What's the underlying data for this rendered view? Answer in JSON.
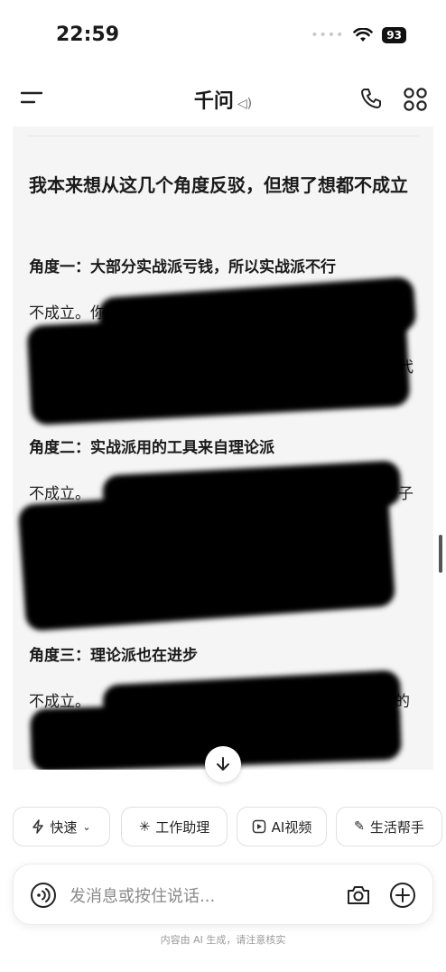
{
  "status_bar": {
    "time": "22:59",
    "battery": "93"
  },
  "nav": {
    "title": "千问"
  },
  "message": {
    "heading": "我本来想从这几个角度反驳，但想了想都不成立",
    "sections": [
      {
        "title": "角度一：大部分实战派亏钱，所以实战派不行",
        "lead": "不成立。你说的是“实战派的认知能力领先”",
        "tail": "不代"
      },
      {
        "title": "角度二：实战派用的工具来自理论派",
        "lead": "不成立。",
        "tail": "子"
      },
      {
        "title": "角度三：理论派也在进步",
        "lead": "不成立。",
        "tail": "理的"
      }
    ]
  },
  "quick_actions": [
    {
      "label": "快速",
      "icon": "lightning-icon"
    },
    {
      "label": "工作助理",
      "icon": "sparkle-icon"
    },
    {
      "label": "AI视频",
      "icon": "video-icon"
    },
    {
      "label": "生活帮手",
      "icon": "life-helper-icon"
    }
  ],
  "input": {
    "placeholder": "发消息或按住说话..."
  },
  "footer": {
    "disclaimer": "内容由 AI 生成，请注意核实"
  }
}
